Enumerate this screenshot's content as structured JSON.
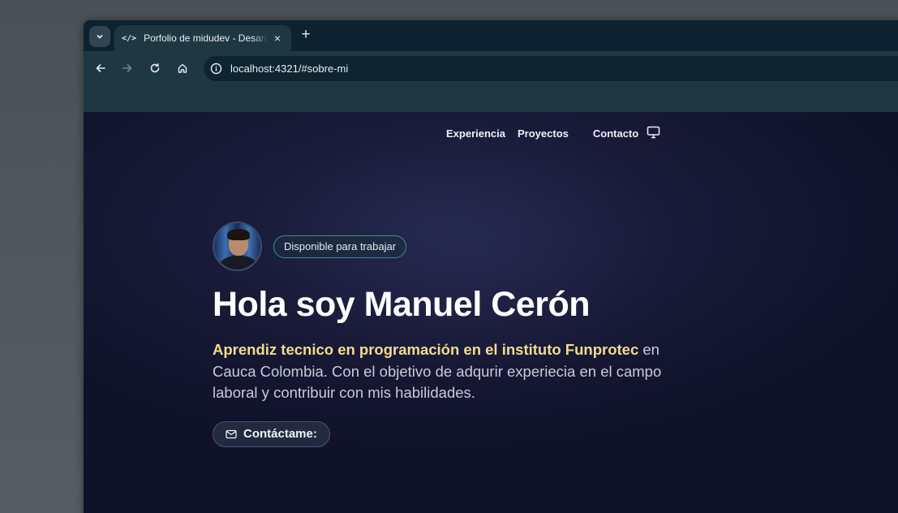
{
  "browser": {
    "tab_title": "Porfolio de midudev - Desarrollador",
    "tab_favicon": "</>",
    "tab_close": "×",
    "new_tab": "+",
    "url": "localhost:4321/#sobre-mi"
  },
  "nav": {
    "items": [
      "Experiencia",
      "Proyectos",
      "Contacto"
    ],
    "theme_icon": "monitor-icon"
  },
  "hero": {
    "badge": "Disponible para trabajar",
    "title": "Hola soy Manuel Cerón",
    "description_highlight": "Aprendiz tecnico en programación en el instituto Funprotec",
    "description_rest": " en Cauca Colombia. Con el objetivo de adqurir experiecia en el campo laboral y contribuir con mis habilidades.",
    "cta_label": "Contáctame:",
    "cta_icon": "mail-icon"
  },
  "colors": {
    "page_bg": "#171936",
    "highlight": "#f2dc8c",
    "badge_border": "#3f8f87",
    "browser_chrome": "#1e3843"
  }
}
